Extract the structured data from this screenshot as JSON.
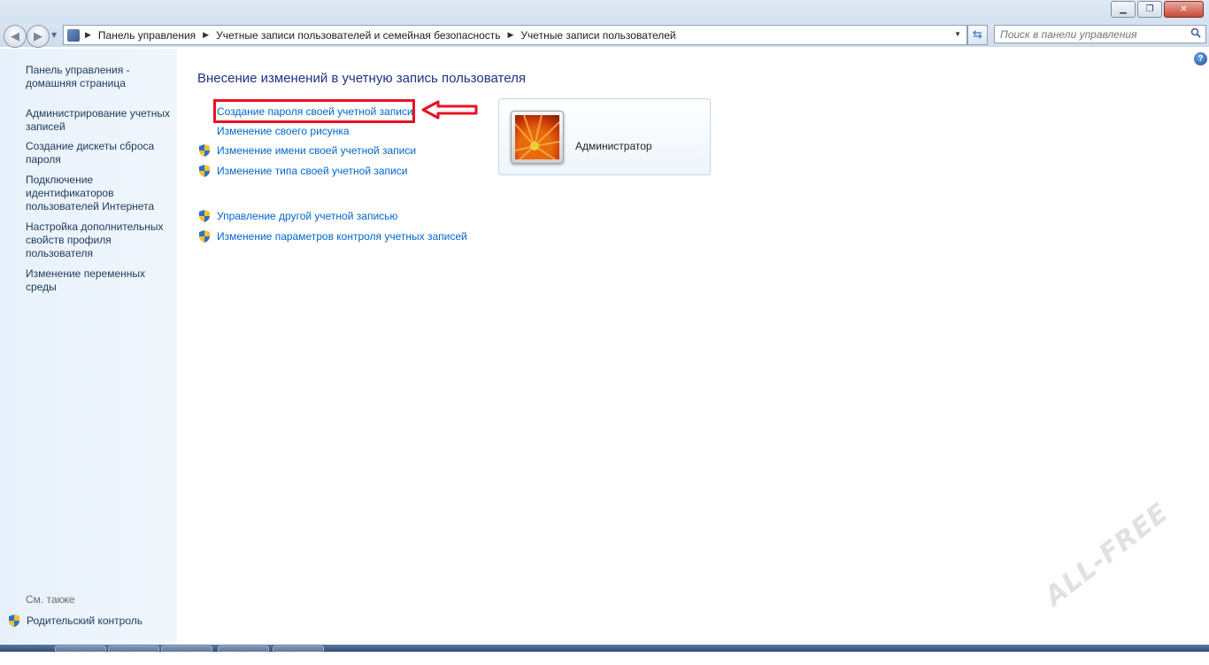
{
  "window": {
    "min_label": "▁",
    "max_label": "❐",
    "close_label": "✕"
  },
  "address_bar": {
    "crumbs": [
      "Панель управления",
      "Учетные записи пользователей и семейная безопасность",
      "Учетные записи пользователей"
    ]
  },
  "search": {
    "placeholder": "Поиск в панели управления"
  },
  "sidebar": {
    "links": [
      "Панель управления - домашняя страница",
      "Администрирование учетных записей",
      "Создание дискеты сброса пароля",
      "Подключение идентификаторов пользователей Интернета",
      "Настройка дополнительных свойств профиля пользователя",
      "Изменение переменных среды"
    ],
    "see_also_label": "См. также",
    "parental_control": "Родительский контроль"
  },
  "main": {
    "heading": "Внесение изменений в учетную запись пользователя",
    "tasks": [
      "Создание пароля своей учетной записи",
      "Изменение своего рисунка",
      "Изменение имени своей учетной записи",
      "Изменение типа своей учетной записи"
    ],
    "other_tasks": [
      "Управление другой учетной записью",
      "Изменение параметров контроля учетных записей"
    ],
    "user": {
      "name": "Администратор"
    }
  },
  "colors": {
    "link": "#0066cc",
    "heading": "#1e3287",
    "highlight": "#e81123"
  },
  "icons": {
    "shield": "uac-shield-icon",
    "help": "help-icon",
    "search": "search-icon"
  }
}
